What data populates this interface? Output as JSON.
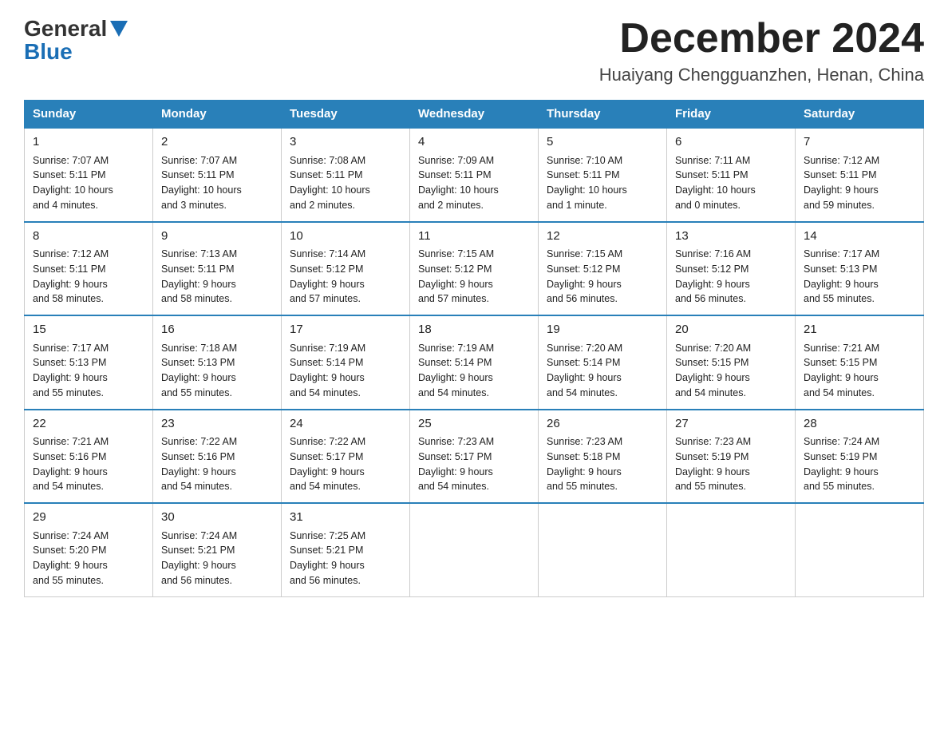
{
  "logo": {
    "general": "General",
    "blue": "Blue"
  },
  "title": "December 2024",
  "location": "Huaiyang Chengguanzhen, Henan, China",
  "days_of_week": [
    "Sunday",
    "Monday",
    "Tuesday",
    "Wednesday",
    "Thursday",
    "Friday",
    "Saturday"
  ],
  "weeks": [
    [
      {
        "day": "1",
        "info": "Sunrise: 7:07 AM\nSunset: 5:11 PM\nDaylight: 10 hours\nand 4 minutes."
      },
      {
        "day": "2",
        "info": "Sunrise: 7:07 AM\nSunset: 5:11 PM\nDaylight: 10 hours\nand 3 minutes."
      },
      {
        "day": "3",
        "info": "Sunrise: 7:08 AM\nSunset: 5:11 PM\nDaylight: 10 hours\nand 2 minutes."
      },
      {
        "day": "4",
        "info": "Sunrise: 7:09 AM\nSunset: 5:11 PM\nDaylight: 10 hours\nand 2 minutes."
      },
      {
        "day": "5",
        "info": "Sunrise: 7:10 AM\nSunset: 5:11 PM\nDaylight: 10 hours\nand 1 minute."
      },
      {
        "day": "6",
        "info": "Sunrise: 7:11 AM\nSunset: 5:11 PM\nDaylight: 10 hours\nand 0 minutes."
      },
      {
        "day": "7",
        "info": "Sunrise: 7:12 AM\nSunset: 5:11 PM\nDaylight: 9 hours\nand 59 minutes."
      }
    ],
    [
      {
        "day": "8",
        "info": "Sunrise: 7:12 AM\nSunset: 5:11 PM\nDaylight: 9 hours\nand 58 minutes."
      },
      {
        "day": "9",
        "info": "Sunrise: 7:13 AM\nSunset: 5:11 PM\nDaylight: 9 hours\nand 58 minutes."
      },
      {
        "day": "10",
        "info": "Sunrise: 7:14 AM\nSunset: 5:12 PM\nDaylight: 9 hours\nand 57 minutes."
      },
      {
        "day": "11",
        "info": "Sunrise: 7:15 AM\nSunset: 5:12 PM\nDaylight: 9 hours\nand 57 minutes."
      },
      {
        "day": "12",
        "info": "Sunrise: 7:15 AM\nSunset: 5:12 PM\nDaylight: 9 hours\nand 56 minutes."
      },
      {
        "day": "13",
        "info": "Sunrise: 7:16 AM\nSunset: 5:12 PM\nDaylight: 9 hours\nand 56 minutes."
      },
      {
        "day": "14",
        "info": "Sunrise: 7:17 AM\nSunset: 5:13 PM\nDaylight: 9 hours\nand 55 minutes."
      }
    ],
    [
      {
        "day": "15",
        "info": "Sunrise: 7:17 AM\nSunset: 5:13 PM\nDaylight: 9 hours\nand 55 minutes."
      },
      {
        "day": "16",
        "info": "Sunrise: 7:18 AM\nSunset: 5:13 PM\nDaylight: 9 hours\nand 55 minutes."
      },
      {
        "day": "17",
        "info": "Sunrise: 7:19 AM\nSunset: 5:14 PM\nDaylight: 9 hours\nand 54 minutes."
      },
      {
        "day": "18",
        "info": "Sunrise: 7:19 AM\nSunset: 5:14 PM\nDaylight: 9 hours\nand 54 minutes."
      },
      {
        "day": "19",
        "info": "Sunrise: 7:20 AM\nSunset: 5:14 PM\nDaylight: 9 hours\nand 54 minutes."
      },
      {
        "day": "20",
        "info": "Sunrise: 7:20 AM\nSunset: 5:15 PM\nDaylight: 9 hours\nand 54 minutes."
      },
      {
        "day": "21",
        "info": "Sunrise: 7:21 AM\nSunset: 5:15 PM\nDaylight: 9 hours\nand 54 minutes."
      }
    ],
    [
      {
        "day": "22",
        "info": "Sunrise: 7:21 AM\nSunset: 5:16 PM\nDaylight: 9 hours\nand 54 minutes."
      },
      {
        "day": "23",
        "info": "Sunrise: 7:22 AM\nSunset: 5:16 PM\nDaylight: 9 hours\nand 54 minutes."
      },
      {
        "day": "24",
        "info": "Sunrise: 7:22 AM\nSunset: 5:17 PM\nDaylight: 9 hours\nand 54 minutes."
      },
      {
        "day": "25",
        "info": "Sunrise: 7:23 AM\nSunset: 5:17 PM\nDaylight: 9 hours\nand 54 minutes."
      },
      {
        "day": "26",
        "info": "Sunrise: 7:23 AM\nSunset: 5:18 PM\nDaylight: 9 hours\nand 55 minutes."
      },
      {
        "day": "27",
        "info": "Sunrise: 7:23 AM\nSunset: 5:19 PM\nDaylight: 9 hours\nand 55 minutes."
      },
      {
        "day": "28",
        "info": "Sunrise: 7:24 AM\nSunset: 5:19 PM\nDaylight: 9 hours\nand 55 minutes."
      }
    ],
    [
      {
        "day": "29",
        "info": "Sunrise: 7:24 AM\nSunset: 5:20 PM\nDaylight: 9 hours\nand 55 minutes."
      },
      {
        "day": "30",
        "info": "Sunrise: 7:24 AM\nSunset: 5:21 PM\nDaylight: 9 hours\nand 56 minutes."
      },
      {
        "day": "31",
        "info": "Sunrise: 7:25 AM\nSunset: 5:21 PM\nDaylight: 9 hours\nand 56 minutes."
      },
      null,
      null,
      null,
      null
    ]
  ]
}
